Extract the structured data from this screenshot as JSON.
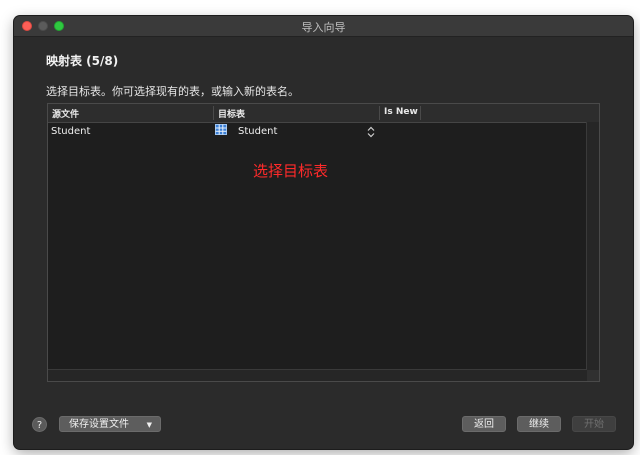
{
  "window": {
    "title": "导入向导"
  },
  "wizard": {
    "step_title": "映射表 (5/8)",
    "instruction": "选择目标表。你可选择现有的表，或输入新的表名。"
  },
  "table": {
    "columns": [
      "源文件",
      "目标表",
      "Is New"
    ],
    "rows": [
      {
        "source": "Student",
        "target": "Student",
        "is_new": ""
      }
    ]
  },
  "annotation": {
    "text": "选择目标表",
    "color": "#ff2a2a"
  },
  "footer": {
    "help_label": "?",
    "save_settings_label": "保存设置文件",
    "back_label": "返回",
    "next_label": "继续",
    "start_label": "开始"
  },
  "icons": {
    "close": "close-icon",
    "minimize": "minimize-icon",
    "maximize": "maximize-icon",
    "table": "table-icon",
    "stepper": "up-down-chevron-icon",
    "dropdown": "caret-down-icon"
  },
  "colors": {
    "window_bg": "#2b2b2b",
    "grid_bg": "#1e1e1e",
    "button_bg": "#5d5d5d",
    "close": "#fc5f57",
    "maximize": "#2fc840"
  }
}
